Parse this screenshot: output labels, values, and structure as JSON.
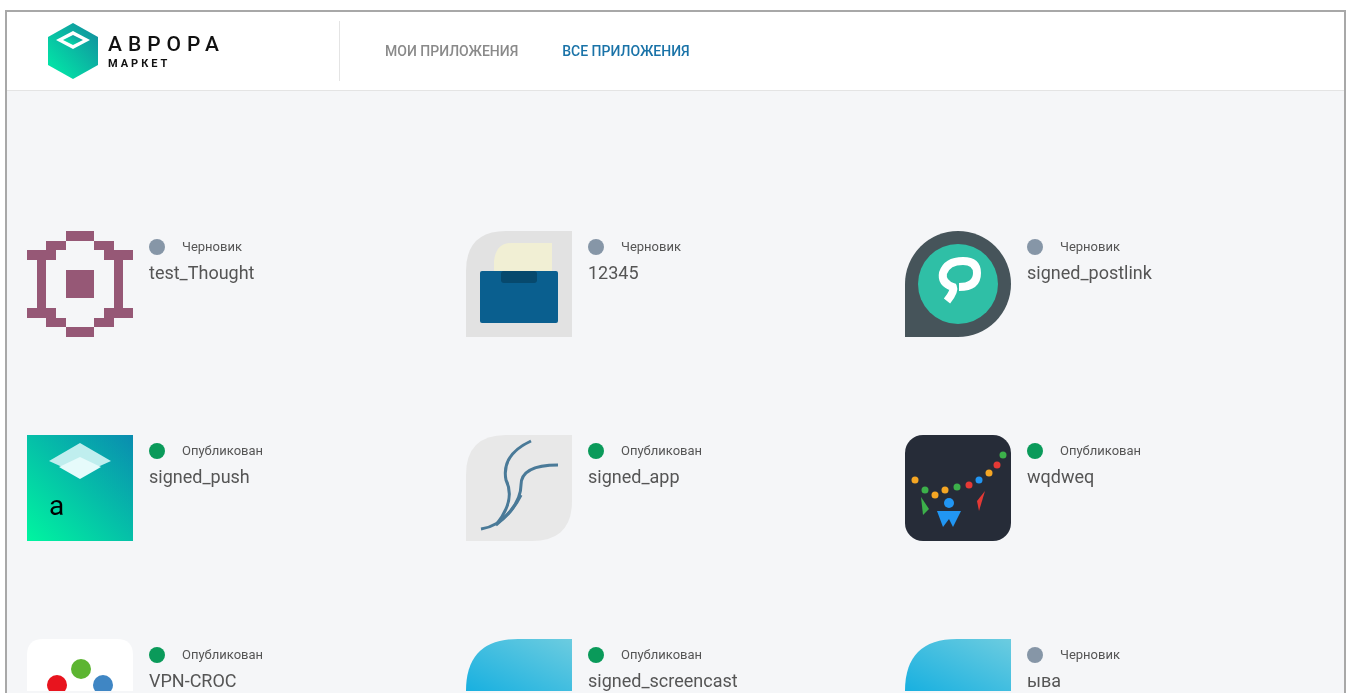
{
  "logo": {
    "title": "АВРОРА",
    "subtitle": "МАРКЕТ"
  },
  "tabs": [
    {
      "label": "МОИ ПРИЛОЖЕНИЯ",
      "selected": false
    },
    {
      "label": "ВСЕ ПРИЛОЖЕНИЯ",
      "selected": true
    }
  ],
  "apps": [
    {
      "name": "test_Thought",
      "status": "Черновик",
      "color": "#8696a7"
    },
    {
      "name": "12345",
      "status": "Черновик",
      "color": "#8696a7"
    },
    {
      "name": "signed_postlink",
      "status": "Черновик",
      "color": "#8696a7"
    },
    {
      "name": "signed_push",
      "status": "Опубликован",
      "color": "#0a9a5a",
      "icon_letter": "a"
    },
    {
      "name": "signed_app",
      "status": "Опубликован",
      "color": "#0a9a5a"
    },
    {
      "name": "wqdweq",
      "status": "Опубликован",
      "color": "#0a9a5a"
    },
    {
      "name": "VPN-CROC",
      "status": "Опубликован",
      "color": "#0a9a5a"
    },
    {
      "name": "signed_screencast",
      "status": "Опубликован",
      "color": "#0a9a5a"
    },
    {
      "name": "ыва",
      "status": "Черновик",
      "color": "#8696a7"
    }
  ]
}
